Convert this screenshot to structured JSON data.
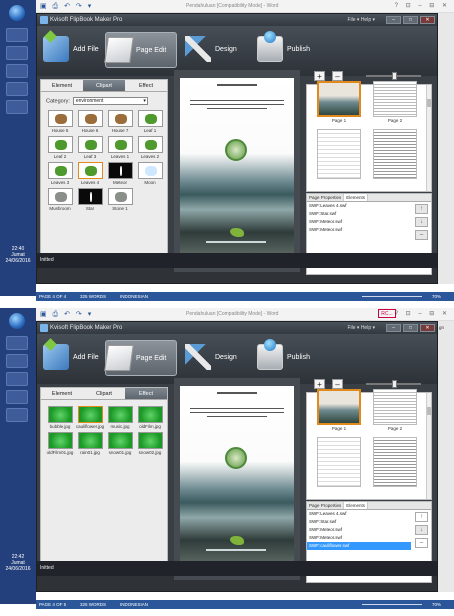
{
  "screens": [
    {
      "word": {
        "title": "Pendahuluan [Compatibility Mode] - Word",
        "controls": "?  ⊡  –  ⊟  ✕",
        "status": {
          "page": "PAGE 4 OF 4",
          "words": "325 WORDS",
          "lang": "INDONESIAN",
          "zoom": "70%"
        }
      },
      "taskbar": {
        "time": "22:40",
        "day": "Jumat",
        "date": "24/06/2016"
      },
      "app": {
        "title": "Kvisoft FlipBook Maker Pro",
        "menu": "File ▾   Help ▾",
        "toolbar": {
          "add_file": "Add File",
          "page_edit": "Page Edit",
          "design": "Design",
          "publish": "Publish"
        },
        "tabs": [
          "Element",
          "Clipart",
          "Effect"
        ],
        "active_tab": 1,
        "category": {
          "label": "Category:",
          "value": "environment"
        },
        "items": [
          "House 5",
          "House 6",
          "House 7",
          "Leaf 1",
          "Leaf 2",
          "Leaf 3",
          "Leaves 1",
          "Leaves 2",
          "Leaves 3",
          "Leaves 4",
          "Meteor",
          "Moon",
          "Mushroom",
          "Star",
          "Stone 1"
        ],
        "selected_item": 9,
        "thumb_labels": [
          "Page 1",
          "Page 2"
        ],
        "prop_tabs": [
          "Page Properties",
          "Elements"
        ],
        "elements": [
          "SWF:Leaves 4.swf",
          "SWF:Star.swf",
          "SWF:Meteor.swf",
          "SWF:Meteor.swf"
        ],
        "selected_element": -1,
        "status": "Initted"
      }
    },
    {
      "word": {
        "title": "Pendahuluan [Compatibility Mode] - Word",
        "controls": "?  ⊡  –  ⊟  ✕",
        "user": "RC...",
        "user_suffix": "gn",
        "status": {
          "page": "PAGE 4 OF 5",
          "words": "325 WORDS",
          "lang": "INDONESIAN",
          "zoom": "70%"
        }
      },
      "taskbar": {
        "time": "22:42",
        "day": "Jumat",
        "date": "24/06/2016"
      },
      "app": {
        "title": "Kvisoft FlipBook Maker Pro",
        "menu": "File ▾   Help ▾",
        "toolbar": {
          "add_file": "Add File",
          "page_edit": "Page Edit",
          "design": "Design",
          "publish": "Publish"
        },
        "tabs": [
          "Element",
          "Clipart",
          "Effect"
        ],
        "active_tab": 2,
        "items": [
          "bubble.jpg",
          "cauliflower.jpg",
          "music.jpg",
          "oldFilm.jpg",
          "oldFilm01.jpg",
          "rain01.jpg",
          "snow01.jpg",
          "snow02.jpg"
        ],
        "selected_item": 1,
        "thumb_labels": [
          "Page 1",
          "Page 2"
        ],
        "prop_tabs": [
          "Page Properties",
          "Elements"
        ],
        "elements": [
          "SWF:Leaves 4.swf",
          "SWF:Star.swf",
          "SWF:Meteor.swf",
          "SWF:Meteor.swf",
          "SWF:cauliflower.swf"
        ],
        "selected_element": 4,
        "status": "Initted"
      }
    }
  ]
}
